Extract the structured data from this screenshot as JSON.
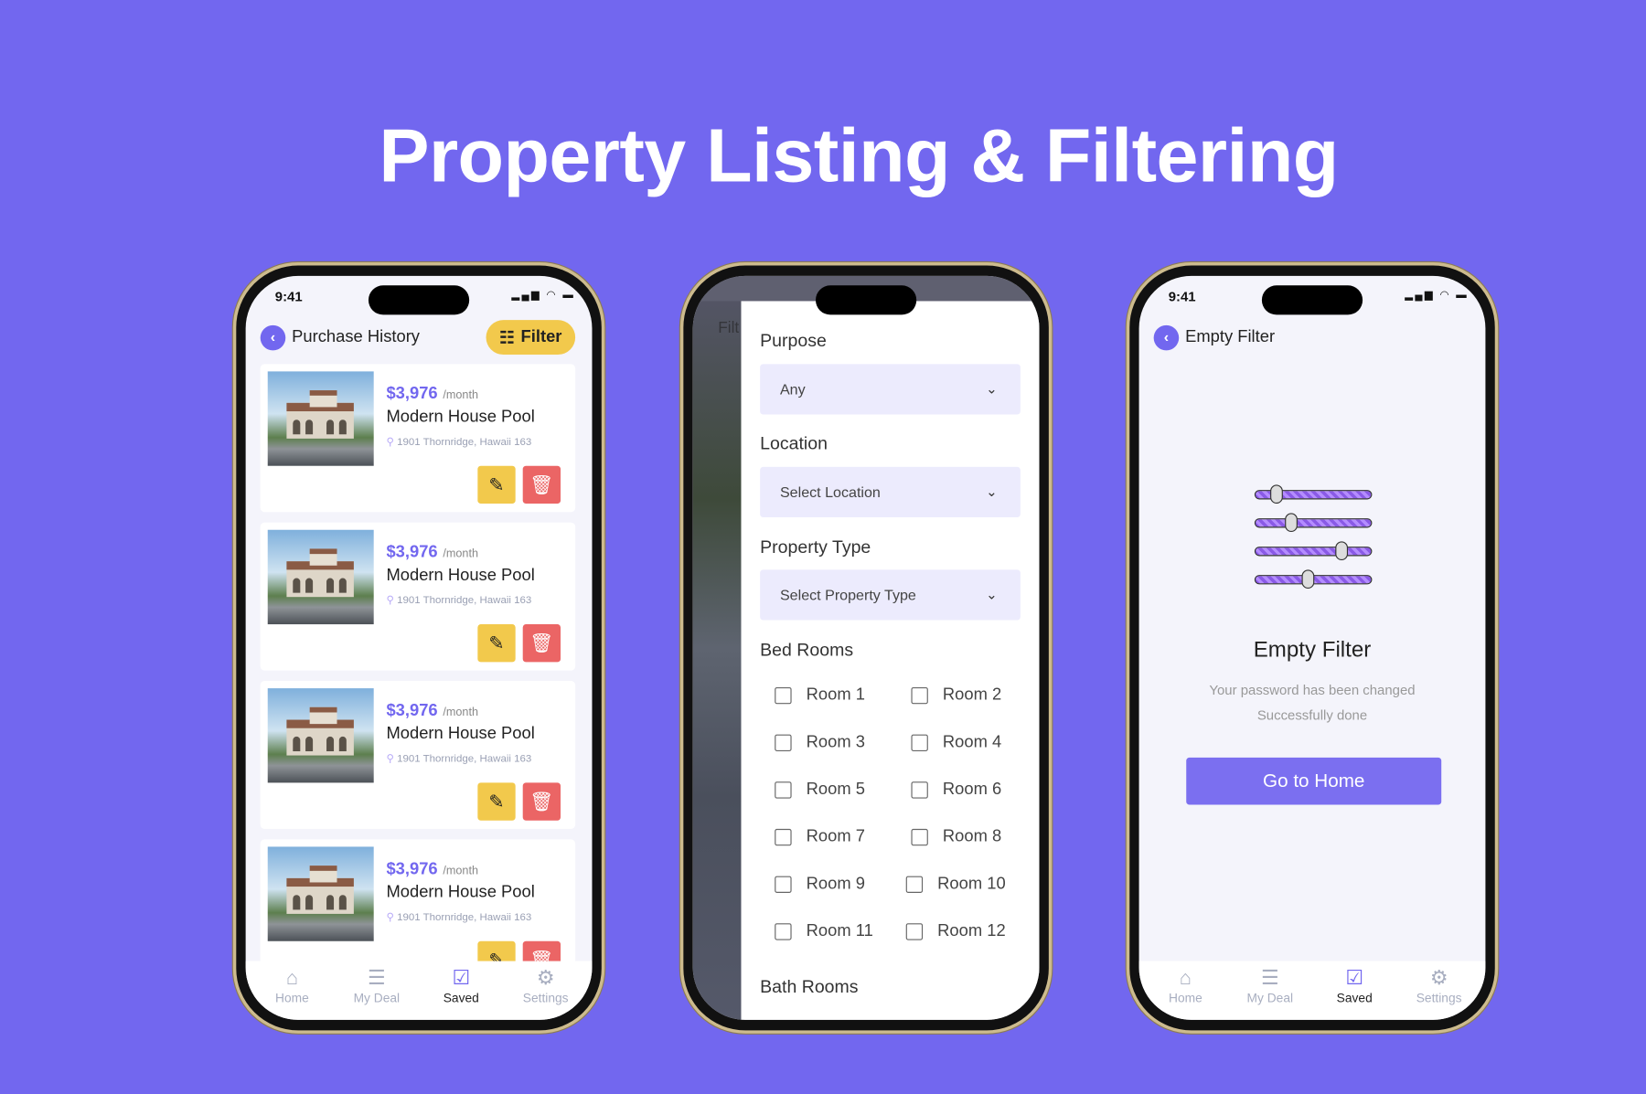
{
  "page_title": "Property Listing & Filtering",
  "colors": {
    "background": "#7267ef",
    "accent": "#7267ef",
    "filter": "#f2c94c",
    "delete": "#eb6565"
  },
  "status_time": "9:41",
  "listing": {
    "header": "Purchase History",
    "filter_label": "Filter",
    "cards": [
      {
        "price": "$3,976",
        "period": "/month",
        "name": "Modern House Pool",
        "address": "1901 Thornridge, Hawaii 163"
      },
      {
        "price": "$3,976",
        "period": "/month",
        "name": "Modern House Pool",
        "address": "1901 Thornridge, Hawaii 163"
      },
      {
        "price": "$3,976",
        "period": "/month",
        "name": "Modern House Pool",
        "address": "1901 Thornridge, Hawaii 163"
      },
      {
        "price": "$3,976",
        "period": "/month",
        "name": "Modern House Pool",
        "address": "1901 Thornridge, Hawaii 163"
      }
    ]
  },
  "nav": [
    {
      "label": "Home",
      "icon": "home-icon",
      "glyph": "⌂",
      "active": false
    },
    {
      "label": "My Deal",
      "icon": "briefcase-icon",
      "glyph": "☰",
      "active": false
    },
    {
      "label": "Saved",
      "icon": "saved-icon",
      "glyph": "☑",
      "active": true
    },
    {
      "label": "Settings",
      "icon": "gear-icon",
      "glyph": "⚙",
      "active": false
    }
  ],
  "filter": {
    "behind_title": "Filt",
    "purpose": {
      "label": "Purpose",
      "value": "Any"
    },
    "location": {
      "label": "Location",
      "value": "Select Location"
    },
    "property_type": {
      "label": "Property Type",
      "value": "Select Property Type"
    },
    "bed_rooms_label": "Bed Rooms",
    "rooms": [
      "Room 1",
      "Room 2",
      "Room 3",
      "Room 4",
      "Room 5",
      "Room 6",
      "Room 7",
      "Room 8",
      "Room 9",
      "Room 10",
      "Room 11",
      "Room 12"
    ],
    "bath_rooms_label": "Bath Rooms"
  },
  "empty": {
    "header": "Empty Filter",
    "title": "Empty Filter",
    "line1": "Your password has been changed",
    "line2": "Successfully done",
    "button": "Go to Home",
    "slider_levels": [
      0.2,
      0.34,
      0.82,
      0.5
    ]
  }
}
